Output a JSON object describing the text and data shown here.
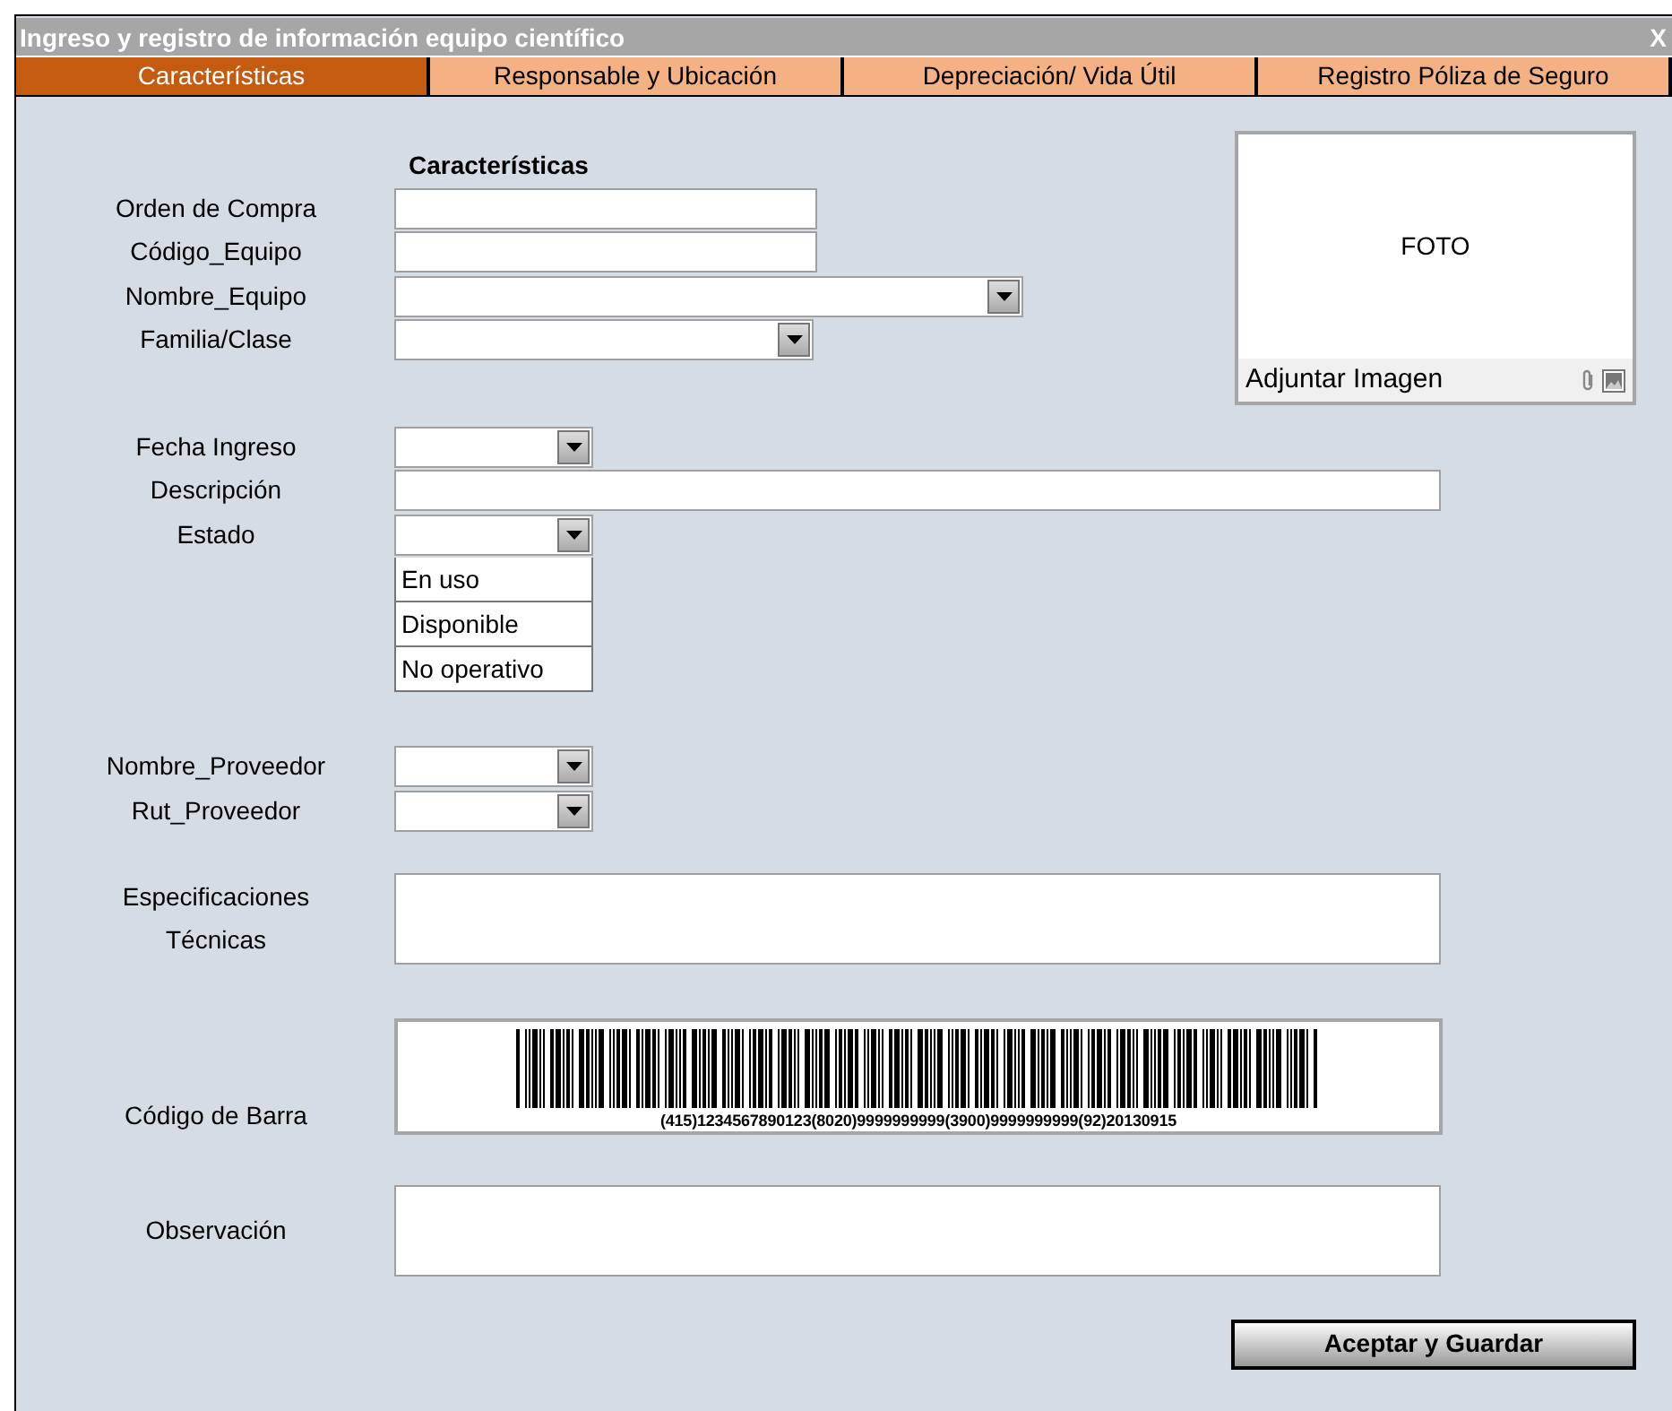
{
  "window": {
    "title": "Ingreso y registro de información equipo científico",
    "close": "X"
  },
  "tabs": [
    {
      "label": "Características",
      "selected": true
    },
    {
      "label": "Responsable y Ubicación",
      "selected": false
    },
    {
      "label": "Depreciación/ Vida Útil",
      "selected": false
    },
    {
      "label": "Registro Póliza de Seguro",
      "selected": false
    }
  ],
  "section_heading": "Características",
  "photo": {
    "text": "FOTO",
    "attach_label": "Adjuntar Imagen"
  },
  "field_groups": [
    [
      {
        "label": "Orden de Compra",
        "kind": "text"
      },
      {
        "label": "Código_Equipo",
        "kind": "text"
      },
      {
        "label": "Nombre_Equipo",
        "kind": "dropdown"
      },
      {
        "label": "Familia/Clase",
        "kind": "dropdown"
      }
    ],
    [
      {
        "label": "Fecha Ingreso",
        "kind": "dropdown"
      },
      {
        "label": "Descripción",
        "kind": "text"
      },
      {
        "label": "Estado",
        "kind": "dropdown",
        "expanded": true,
        "options": [
          "En uso",
          "Disponible",
          "No operativo"
        ]
      }
    ],
    [
      {
        "label": "Nombre_Proveedor",
        "kind": "dropdown"
      },
      {
        "label": "Rut_Proveedor",
        "kind": "dropdown"
      }
    ],
    [
      {
        "label": "Especificaciones Técnicas",
        "kind": "textarea"
      }
    ],
    [
      {
        "label": "Código de Barra",
        "kind": "barcode",
        "caption": "(415)1234567890123(8020)9999999999(3900)9999999999(92)20130915"
      }
    ],
    [
      {
        "label": "Observación",
        "kind": "textarea"
      }
    ]
  ],
  "buttons": [
    "Aceptar y Guardar"
  ]
}
